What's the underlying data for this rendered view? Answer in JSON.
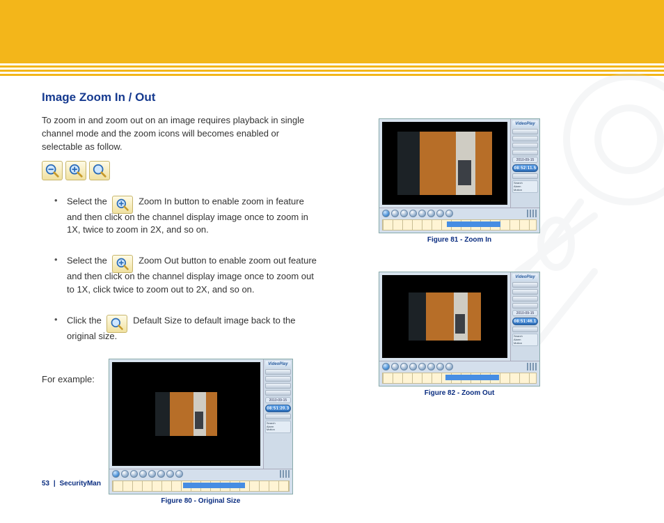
{
  "header": {
    "title": "Image Zoom In / Out"
  },
  "intro": "To zoom in and zoom out on an image requires playback in single channel mode and the zoom icons will becomes enabled or selectable as follow.",
  "icons": {
    "zoom_out": "zoom-out-icon",
    "zoom_in": "zoom-in-icon",
    "default_size": "default-size-icon"
  },
  "bullets": {
    "b1_pre": "Select the ",
    "b1_post": " Zoom In button to enable zoom in feature and then click on the channel display image once to zoom in 1X, twice to zoom in 2X, and so on.",
    "b2_pre": "Select the ",
    "b2_post": " Zoom Out button to enable zoom out feature and then click on the channel display image once to zoom out to 1X, click twice to zoom out to 2X, and so on.",
    "b3_pre": "Click the ",
    "b3_post": " Default Size to default image back to the original size."
  },
  "example_label": "For example:",
  "player": {
    "app_name": "VideoPlay",
    "date": "2010-09-15",
    "legend": [
      "Search",
      "Alarm",
      "Motion"
    ]
  },
  "figures": {
    "f80": {
      "caption": "Figure 80 - Original Size",
      "clock": "08:51:20.3"
    },
    "f81": {
      "caption": "Figure 81 - Zoom In",
      "clock": "08:52:11.5"
    },
    "f82": {
      "caption": "Figure 82 - Zoom Out",
      "clock": "08:51:46.1"
    }
  },
  "footer": {
    "page": "53",
    "sep": "|",
    "brand": "SecurityMan"
  }
}
